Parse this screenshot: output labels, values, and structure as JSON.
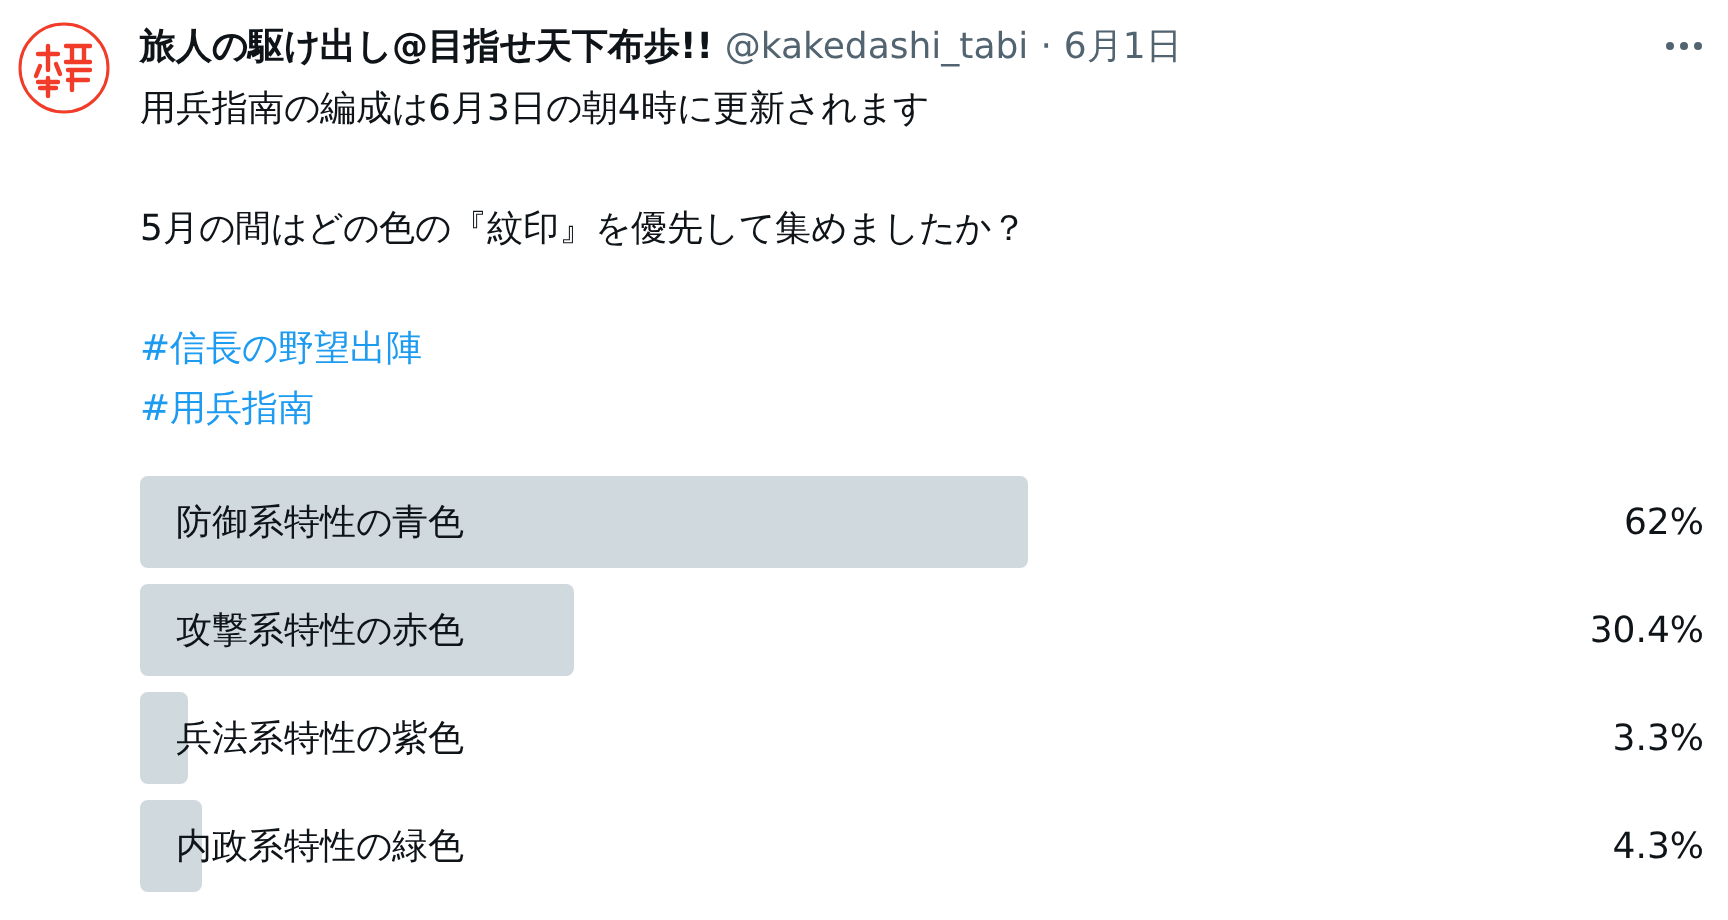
{
  "tweet": {
    "display_name": "旅人の駆け出し@目指せ天下布歩!!",
    "handle": "@kakedashi_tabi",
    "separator": "·",
    "date": "6月1日",
    "body": [
      "用兵指南の編成は6月3日の朝4時に更新されます",
      "5月の間はどの色の『紋印』を優先して集めましたか？"
    ],
    "hashtags": [
      "#信長の野望出陣",
      "#用兵指南"
    ],
    "poll": [
      {
        "label": "防御系特性の青色",
        "level": 0.62,
        "percent": "62%"
      },
      {
        "label": "攻撃系特性の赤色",
        "level": 0.304,
        "percent": "30.4%"
      },
      {
        "label": "兵法系特性の紫色",
        "level": 0.033,
        "percent": "3.3%"
      },
      {
        "label": "内政系特性の緑色",
        "level": 0.043,
        "percent": "4.3%"
      }
    ]
  }
}
